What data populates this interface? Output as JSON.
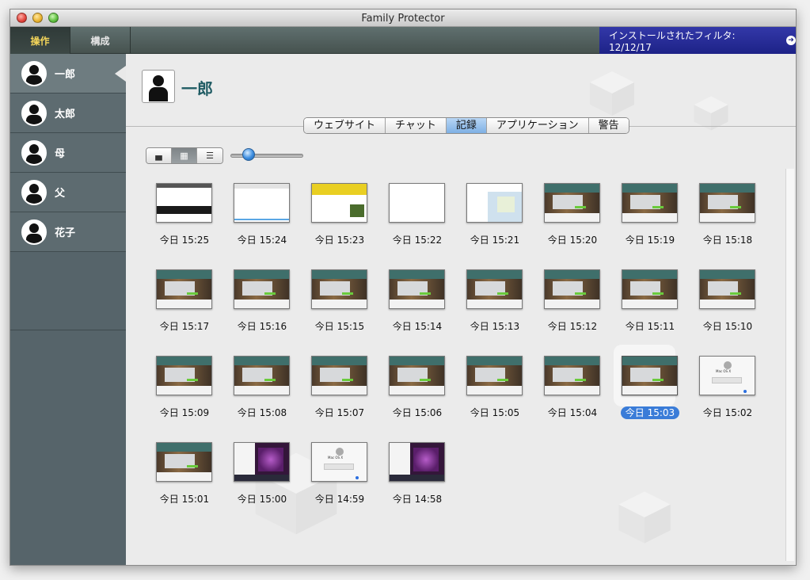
{
  "window": {
    "title": "Family Protector"
  },
  "toolbar": {
    "tabs": [
      "操作",
      "構成"
    ],
    "filter_text": "インストールされたフィルタ: 12/12/17",
    "filter_arrow": "➜"
  },
  "sidebar": {
    "users": [
      "一郎",
      "太郎",
      "母",
      "父",
      "花子"
    ],
    "selected_index": 0
  },
  "header": {
    "user_name": "一郎"
  },
  "tabs": [
    "ウェブサイト",
    "チャット",
    "記録",
    "アプリケーション",
    "警告"
  ],
  "active_tab": "記録",
  "view_modes": [
    "flow-view-icon",
    "grid-view-icon",
    "list-view-icon"
  ],
  "active_view_mode": "grid-view-icon",
  "zoom_slider": {
    "value": 0.2
  },
  "accent_color": "#3a7cd8",
  "records": [
    {
      "label": "今日 15:25",
      "thumb": "web1"
    },
    {
      "label": "今日 15:24",
      "thumb": "web2"
    },
    {
      "label": "今日 15:23",
      "thumb": "yel"
    },
    {
      "label": "今日 15:22",
      "thumb": "blank"
    },
    {
      "label": "今日 15:21",
      "thumb": "map"
    },
    {
      "label": "今日 15:20",
      "thumb": "dark"
    },
    {
      "label": "今日 15:19",
      "thumb": "dark"
    },
    {
      "label": "今日 15:18",
      "thumb": "dark"
    },
    {
      "label": "今日 15:17",
      "thumb": "dark"
    },
    {
      "label": "今日 15:16",
      "thumb": "dark"
    },
    {
      "label": "今日 15:15",
      "thumb": "dark"
    },
    {
      "label": "今日 15:14",
      "thumb": "dark"
    },
    {
      "label": "今日 15:13",
      "thumb": "dark"
    },
    {
      "label": "今日 15:12",
      "thumb": "dark"
    },
    {
      "label": "今日 15:11",
      "thumb": "dark"
    },
    {
      "label": "今日 15:10",
      "thumb": "dark"
    },
    {
      "label": "今日 15:09",
      "thumb": "dark"
    },
    {
      "label": "今日 15:08",
      "thumb": "dark"
    },
    {
      "label": "今日 15:07",
      "thumb": "dark"
    },
    {
      "label": "今日 15:06",
      "thumb": "dark"
    },
    {
      "label": "今日 15:05",
      "thumb": "dark"
    },
    {
      "label": "今日 15:04",
      "thumb": "dark"
    },
    {
      "label": "今日 15:03",
      "thumb": "dark",
      "selected": true
    },
    {
      "label": "今日 15:02",
      "thumb": "osx"
    },
    {
      "label": "今日 15:01",
      "thumb": "dark"
    },
    {
      "label": "今日 15:00",
      "thumb": "ipad"
    },
    {
      "label": "今日 14:59",
      "thumb": "osx"
    },
    {
      "label": "今日 14:58",
      "thumb": "ipad"
    }
  ],
  "osx_thumb_text": "Mac OS X"
}
